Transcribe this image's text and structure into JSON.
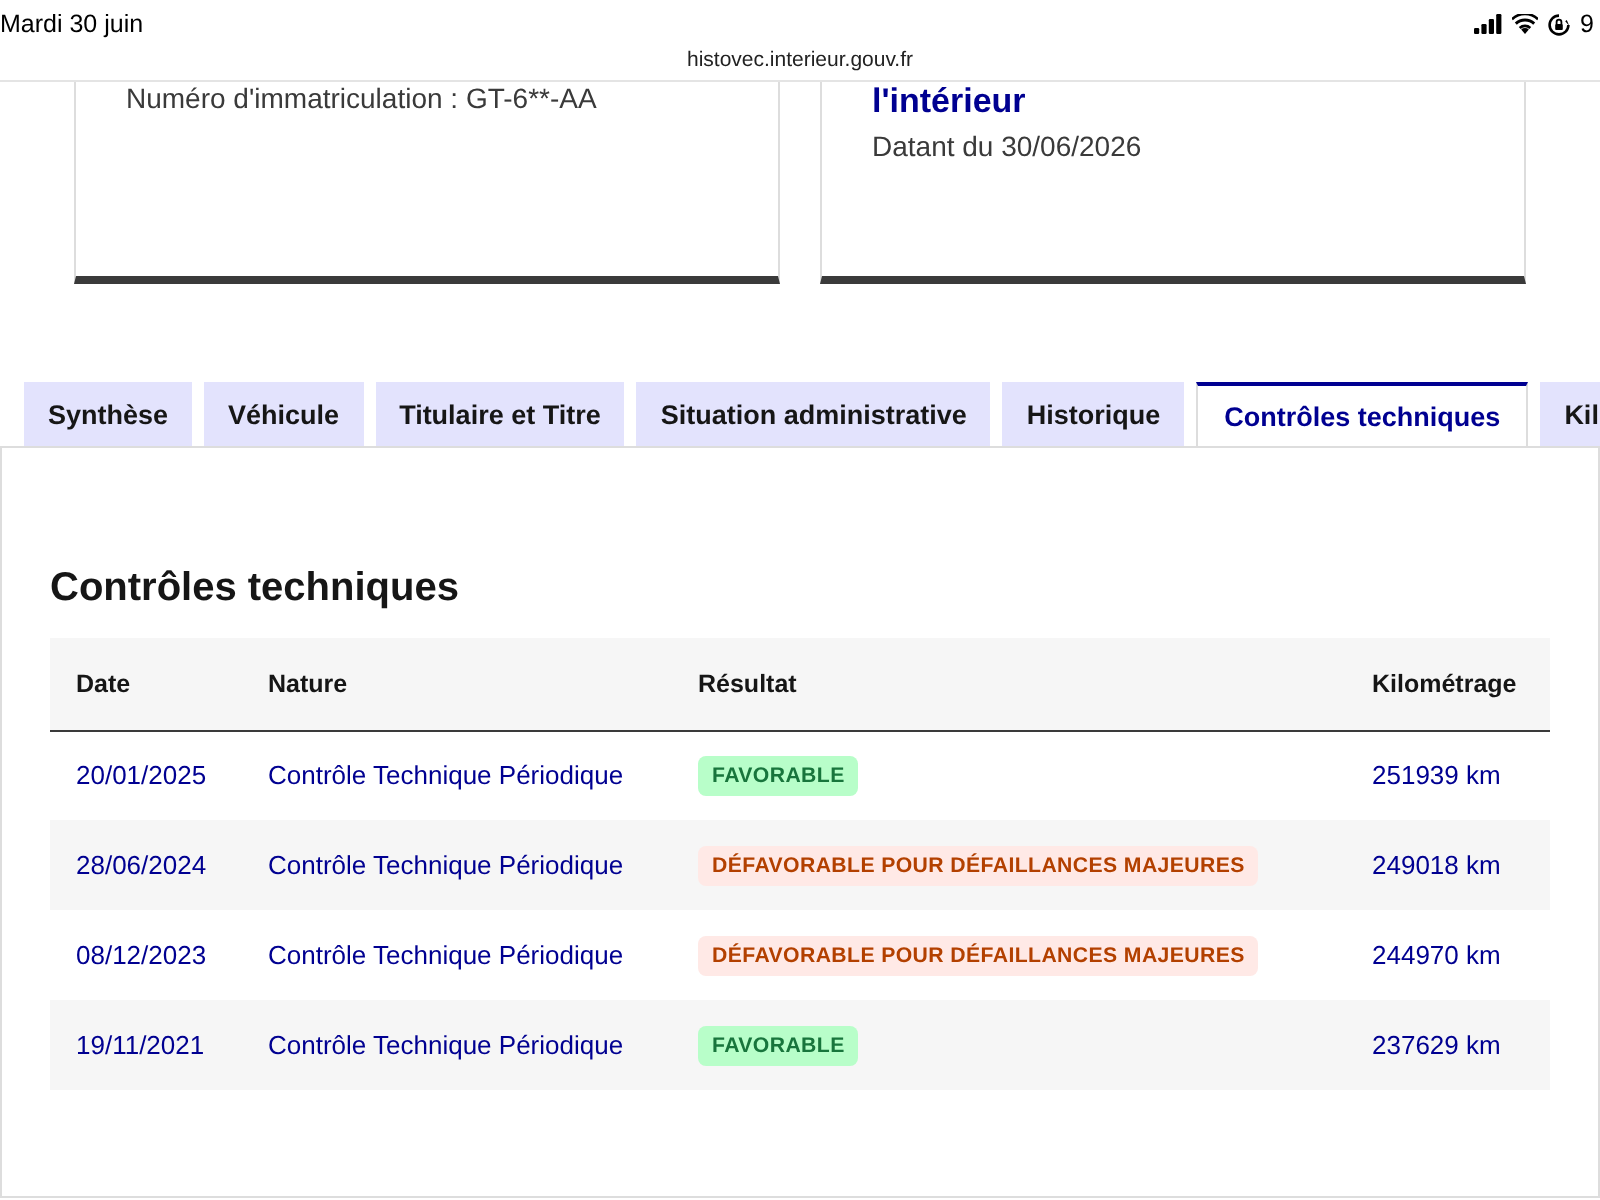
{
  "status_bar": {
    "date": "Mardi 30 juin",
    "battery": "9"
  },
  "address_bar": {
    "url": "histovec.interieur.gouv.fr"
  },
  "cards": [
    {
      "lines": [
        "Numéro d'immatriculation : GT-6**-AA"
      ]
    },
    {
      "title": "l'intérieur",
      "lines": [
        "Datant du 30/06/2026"
      ]
    }
  ],
  "tabs": [
    {
      "label": "Synthèse",
      "selected": false
    },
    {
      "label": "Véhicule",
      "selected": false
    },
    {
      "label": "Titulaire et Titre",
      "selected": false
    },
    {
      "label": "Situation administrative",
      "selected": false
    },
    {
      "label": "Historique",
      "selected": false
    },
    {
      "label": "Contrôles techniques",
      "selected": true
    },
    {
      "label": "Kil",
      "selected": false
    }
  ],
  "panel": {
    "title": "Contrôles techniques",
    "table": {
      "columns": [
        "Date",
        "Nature",
        "Résultat",
        "Kilométrage"
      ],
      "rows": [
        {
          "date": "20/01/2025",
          "nature": "Contrôle Technique Périodique",
          "result": {
            "label": "FAVORABLE",
            "kind": "favorable"
          },
          "mileage": "251939 km"
        },
        {
          "date": "28/06/2024",
          "nature": "Contrôle Technique Périodique",
          "result": {
            "label": "DÉFAVORABLE POUR DÉFAILLANCES MAJEURES",
            "kind": "unfavorable"
          },
          "mileage": "249018 km"
        },
        {
          "date": "08/12/2023",
          "nature": "Contrôle Technique Périodique",
          "result": {
            "label": "DÉFAVORABLE POUR DÉFAILLANCES MAJEURES",
            "kind": "unfavorable"
          },
          "mileage": "244970 km"
        },
        {
          "date": "19/11/2021",
          "nature": "Contrôle Technique Périodique",
          "result": {
            "label": "FAVORABLE",
            "kind": "favorable"
          },
          "mileage": "237629 km"
        }
      ]
    }
  }
}
